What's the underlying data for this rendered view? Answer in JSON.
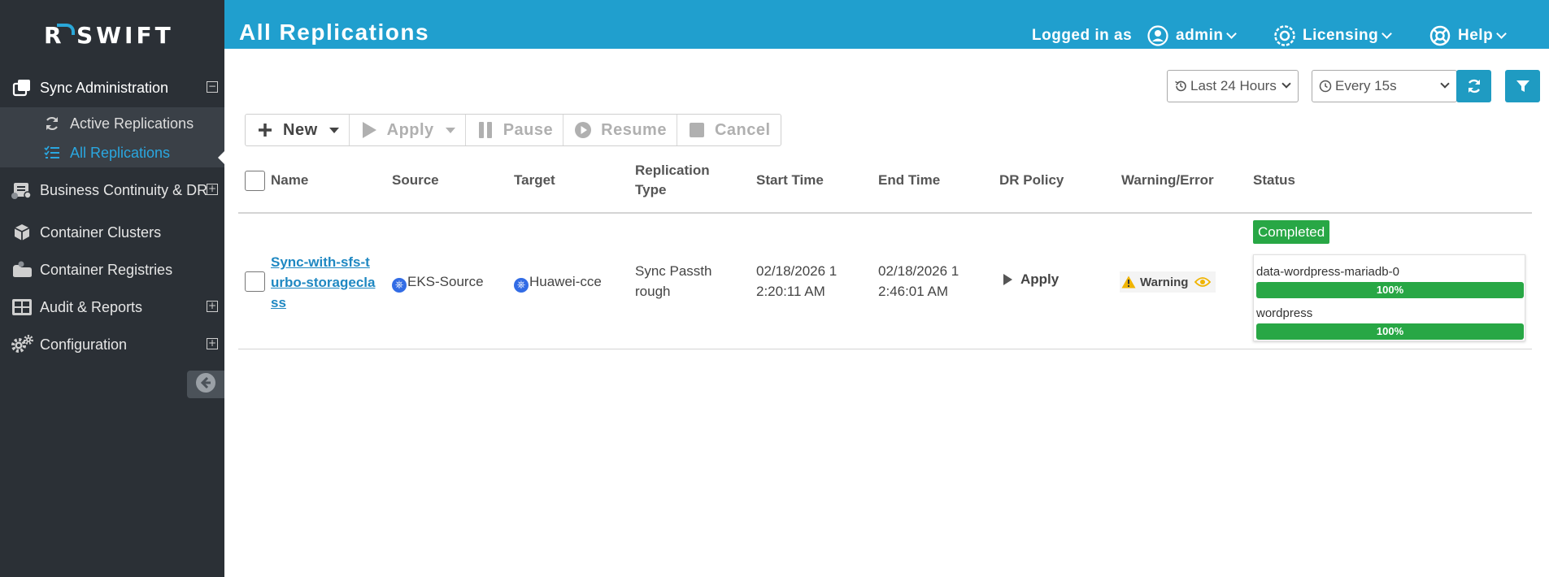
{
  "app": {
    "logo_text": "SWIFT",
    "logo_letter": "R"
  },
  "sidebar": {
    "items": [
      {
        "label": "Sync Administration",
        "toggle": "−"
      },
      {
        "label": "Business Continuity & DR",
        "toggle": "+"
      },
      {
        "label": "Container Clusters"
      },
      {
        "label": "Container Registries"
      },
      {
        "label": "Audit & Reports",
        "toggle": "+"
      },
      {
        "label": "Configuration",
        "toggle": "+"
      }
    ],
    "sub_items": [
      {
        "label": "Active Replications"
      },
      {
        "label": "All Replications"
      }
    ]
  },
  "header": {
    "title": "All Replications",
    "logged_in_label": "Logged in as",
    "user": "admin",
    "licensing": "Licensing",
    "help": "Help"
  },
  "filters": {
    "time_range": "Last 24 Hours",
    "refresh_interval": "Every 15s"
  },
  "actions": {
    "new": "New",
    "apply": "Apply",
    "pause": "Pause",
    "resume": "Resume",
    "cancel": "Cancel"
  },
  "table": {
    "headers": {
      "name": "Name",
      "source": "Source",
      "target": "Target",
      "type_line1": "Replication",
      "type_line2": "Type",
      "start": "Start Time",
      "end": "End Time",
      "policy": "DR Policy",
      "warning": "Warning/Error",
      "status": "Status"
    },
    "rows": [
      {
        "name": "Sync-with-sfs-turbo-storageclass",
        "source": "EKS-Source",
        "target": "Huawei-cce",
        "type": "Sync Passthrough",
        "start": "02/18/2026 12:20:11 AM",
        "end": "02/18/2026 12:46:01 AM",
        "policy": "Apply",
        "warning": "Warning",
        "status": "Completed",
        "volumes": [
          {
            "name": "data-wordpress-mariadb-0",
            "progress": "100%"
          },
          {
            "name": "wordpress",
            "progress": "100%"
          }
        ]
      }
    ]
  },
  "colors": {
    "header": "#209fce",
    "sidebar": "#2b3036",
    "accent": "#2aa7e0",
    "success": "#28a745",
    "warning": "#f0b400"
  }
}
